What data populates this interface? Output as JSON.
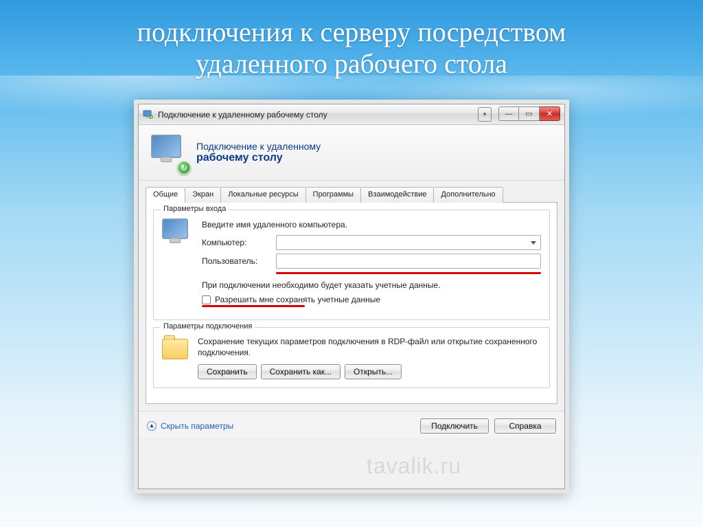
{
  "slide": {
    "title_line1": "подключения к серверу посредством",
    "title_line2": "удаленного рабочего стола"
  },
  "window": {
    "title": "Подключение к удаленному рабочему столу",
    "header_line1": "Подключение к удаленному",
    "header_line2": "рабочему столу"
  },
  "tabs": [
    "Общие",
    "Экран",
    "Локальные ресурсы",
    "Программы",
    "Взаимодействие",
    "Дополнительно"
  ],
  "active_tab": 0,
  "login_group": {
    "legend": "Параметры входа",
    "hint": "Введите имя удаленного компьютера.",
    "computer_label": "Компьютер:",
    "computer_value": "",
    "user_label": "Пользователь:",
    "user_value": "",
    "note": "При подключении необходимо будет указать учетные данные.",
    "checkbox_label": "Разрешить мне сохранять учетные данные",
    "checkbox_checked": false
  },
  "conn_group": {
    "legend": "Параметры подключения",
    "text": "Сохранение текущих параметров подключения в RDP-файл или открытие сохраненного подключения.",
    "buttons": [
      "Сохранить",
      "Сохранить как...",
      "Открыть..."
    ]
  },
  "bottom": {
    "hide_params": "Скрыть параметры",
    "connect": "Подключить",
    "help": "Справка"
  },
  "watermark": "tavalik.ru",
  "win_controls": {
    "minimize": "—",
    "maximize": "▭",
    "close": "✕",
    "dropdown": "▾"
  }
}
